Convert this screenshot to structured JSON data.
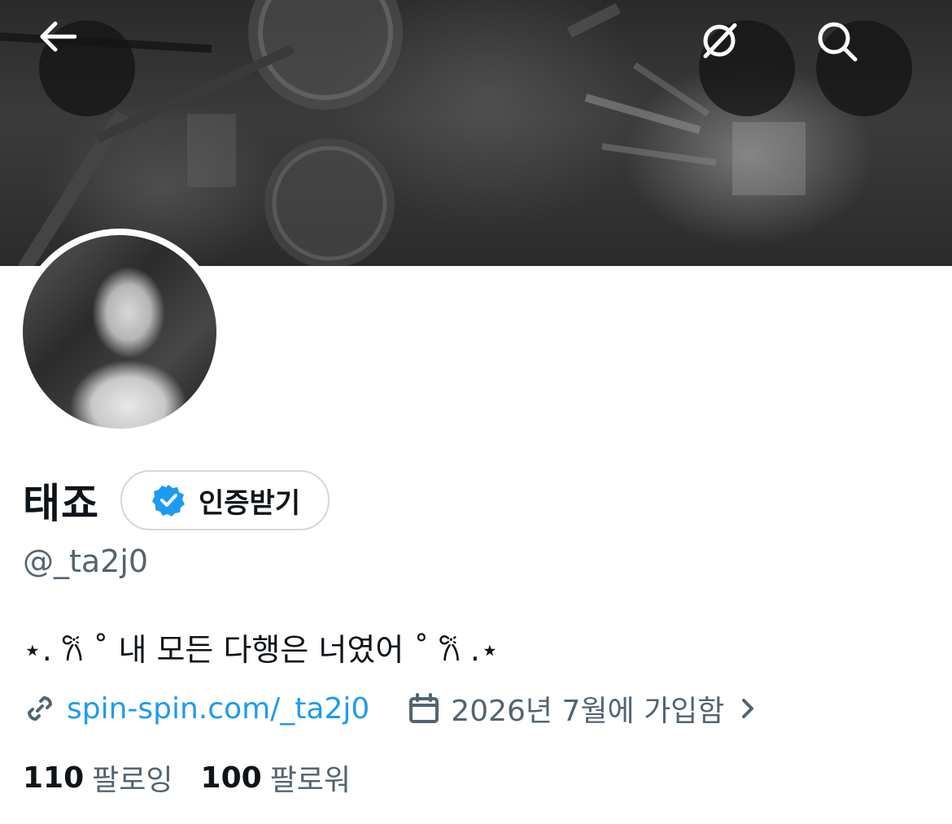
{
  "profile": {
    "display_name": "태죠",
    "verify_label": "인증받기",
    "handle": "@_ta2j0",
    "bio": "⋆. 𐙚 ˚ 내 모든 다행은 너였어 ˚ 𐙚 .⋆",
    "website": "spin-spin.com/_ta2j0",
    "joined": "2026년 7월에 가입함",
    "following_count": "110",
    "following_label": "팔로잉",
    "followers_count": "100",
    "followers_label": "팔로워"
  },
  "icons": {
    "back": "arrow-left-icon",
    "grok": "grok-icon",
    "search": "search-icon",
    "verified": "verified-badge-icon",
    "link": "link-icon",
    "calendar": "calendar-icon",
    "chevron": "chevron-right-icon"
  },
  "colors": {
    "accent": "#1d9bf0",
    "secondary_text": "#536471",
    "border": "#cfd9de"
  }
}
